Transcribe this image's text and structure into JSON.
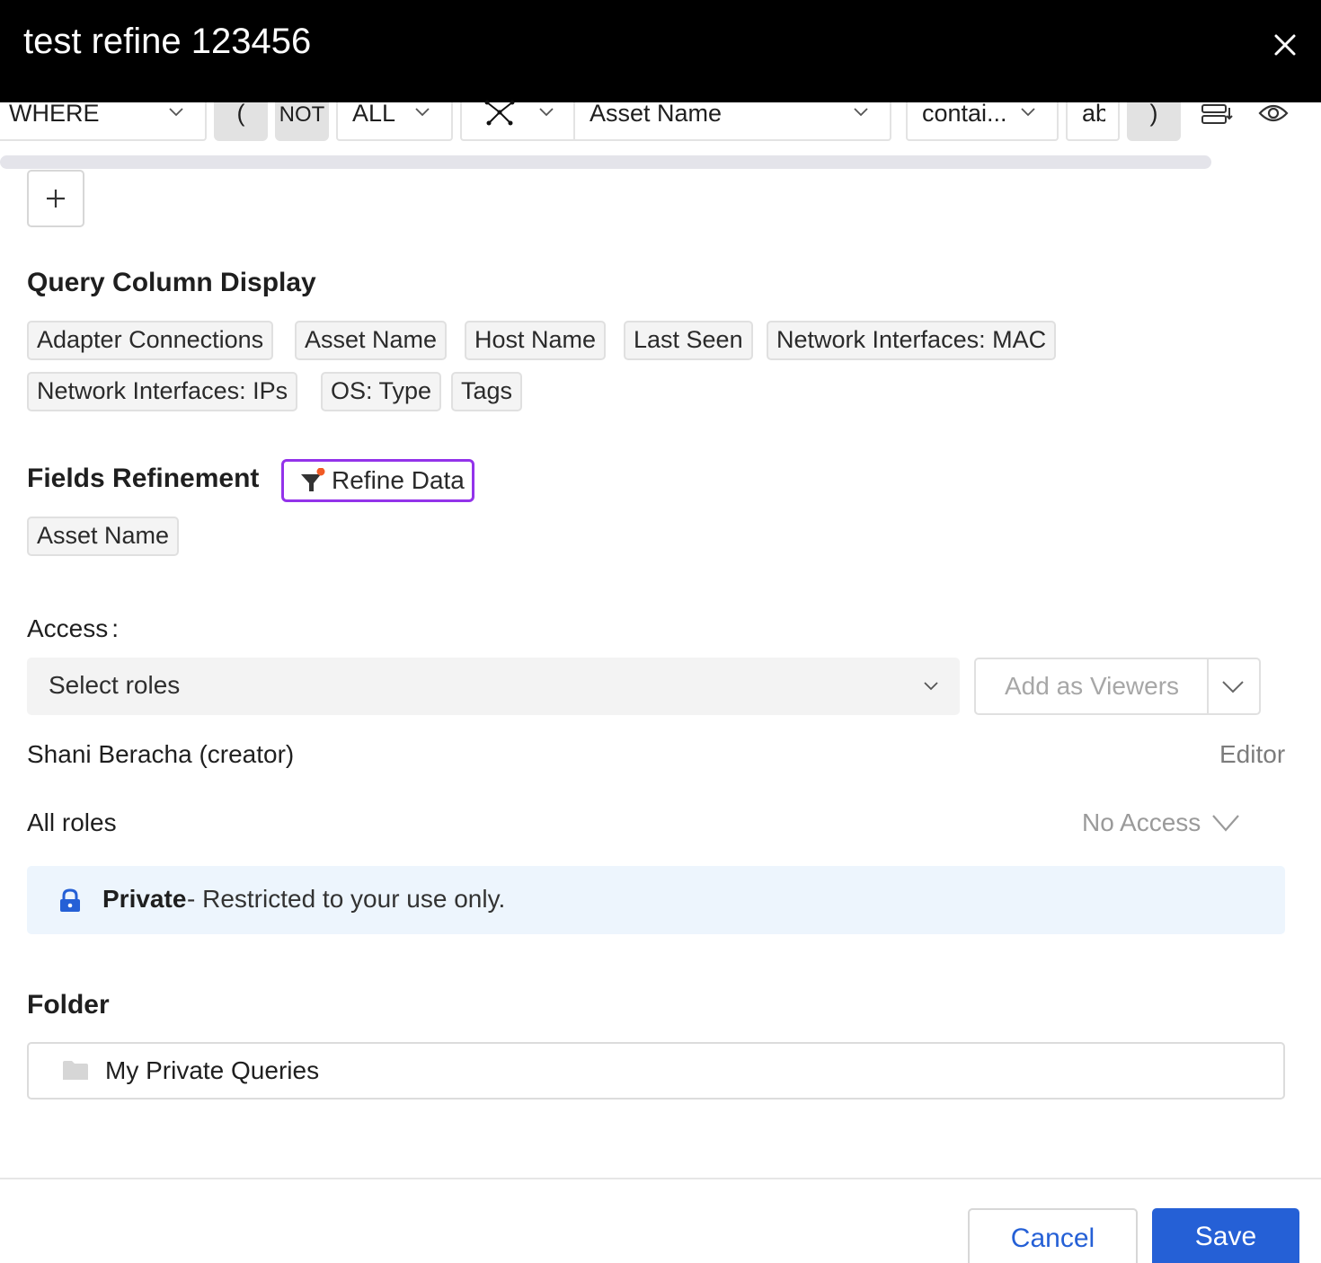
{
  "dialog": {
    "title": "test refine 123456"
  },
  "query_row": {
    "where": "WHERE",
    "open_paren": "(",
    "not": "NOT",
    "all": "ALL",
    "field": "Asset Name",
    "operator": "contai...",
    "value": "ab",
    "close_paren": ")"
  },
  "column_display": {
    "title": "Query Column Display",
    "chips": [
      "Adapter Connections",
      "Asset Name",
      "Host Name",
      "Last Seen",
      "Network Interfaces: MAC",
      "Network Interfaces: IPs",
      "OS: Type",
      "Tags"
    ]
  },
  "fields_refinement": {
    "title": "Fields Refinement",
    "button": "Refine Data",
    "chips": [
      "Asset Name"
    ]
  },
  "access": {
    "label": "Access",
    "colon": ":",
    "roles_placeholder": "Select roles",
    "viewers_button": "Add as Viewers",
    "creator_name": "Shani Beracha (creator)",
    "creator_role": "Editor",
    "all_roles_label": "All roles",
    "all_roles_value": "No Access",
    "private_strong": "Private",
    "private_rest": "- Restricted to your use only."
  },
  "folder": {
    "title": "Folder",
    "value": "My Private Queries"
  },
  "footer": {
    "cancel": "Cancel",
    "save": "Save"
  },
  "colors": {
    "accent": "#2560d6",
    "refine_border": "#9333ea",
    "private_bg": "#edf5fd",
    "header_bg": "#000000"
  }
}
